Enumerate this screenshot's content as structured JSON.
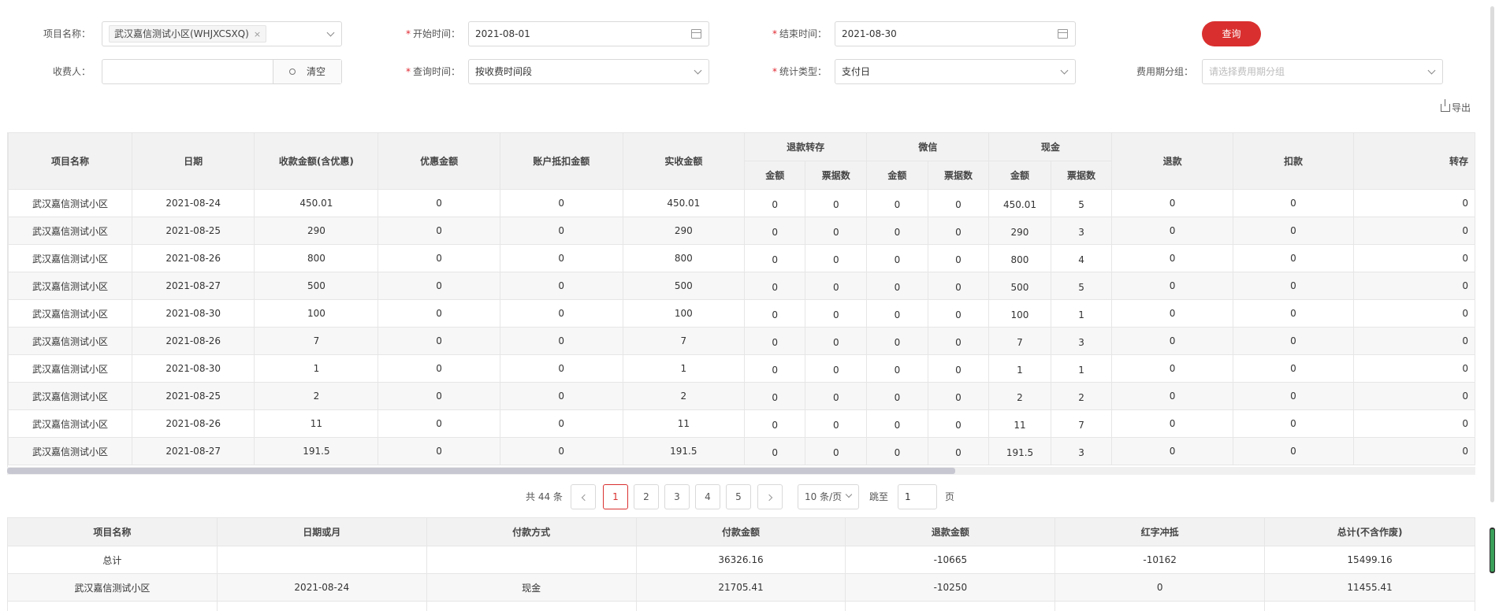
{
  "filters": {
    "project_label": "项目名称：",
    "project_tag": "武汉嘉信测试小区(WHJXCSXQ)",
    "project_tag_close": "×",
    "start_label": "开始时间：",
    "start_value": "2021-08-01",
    "end_label": "结束时间：",
    "end_value": "2021-08-30",
    "query_button": "查询",
    "payee_label": "收费人：",
    "payee_value": "",
    "clear_button": "清空",
    "query_time_label": "查询时间：",
    "query_time_value": "按收费时间段",
    "stat_type_label": "统计类型：",
    "stat_type_value": "支付日",
    "fee_group_label": "费用期分组：",
    "fee_group_placeholder": "请选择费用期分组",
    "export_label": "导出"
  },
  "main_table": {
    "headers": {
      "project": "项目名称",
      "date": "日期",
      "receivable": "收款金额(含优惠)",
      "discount": "优惠金额",
      "account_offset": "账户抵扣金额",
      "actual": "实收金额",
      "refund_transfer": "退款转存",
      "wechat": "微信",
      "cash": "现金",
      "refund": "退款",
      "deduction": "扣款",
      "transfer": "转存",
      "amount": "金额",
      "ticket_count": "票据数"
    },
    "rows": [
      [
        "武汉嘉信测试小区",
        "2021-08-24",
        "450.01",
        "0",
        "0",
        "450.01",
        "0",
        "0",
        "0",
        "0",
        "450.01",
        "5",
        "0",
        "0",
        "0"
      ],
      [
        "武汉嘉信测试小区",
        "2021-08-25",
        "290",
        "0",
        "0",
        "290",
        "0",
        "0",
        "0",
        "0",
        "290",
        "3",
        "0",
        "0",
        "0"
      ],
      [
        "武汉嘉信测试小区",
        "2021-08-26",
        "800",
        "0",
        "0",
        "800",
        "0",
        "0",
        "0",
        "0",
        "800",
        "4",
        "0",
        "0",
        "0"
      ],
      [
        "武汉嘉信测试小区",
        "2021-08-27",
        "500",
        "0",
        "0",
        "500",
        "0",
        "0",
        "0",
        "0",
        "500",
        "5",
        "0",
        "0",
        "0"
      ],
      [
        "武汉嘉信测试小区",
        "2021-08-30",
        "100",
        "0",
        "0",
        "100",
        "0",
        "0",
        "0",
        "0",
        "100",
        "1",
        "0",
        "0",
        "0"
      ],
      [
        "武汉嘉信测试小区",
        "2021-08-26",
        "7",
        "0",
        "0",
        "7",
        "0",
        "0",
        "0",
        "0",
        "7",
        "3",
        "0",
        "0",
        "0"
      ],
      [
        "武汉嘉信测试小区",
        "2021-08-30",
        "1",
        "0",
        "0",
        "1",
        "0",
        "0",
        "0",
        "0",
        "1",
        "1",
        "0",
        "0",
        "0"
      ],
      [
        "武汉嘉信测试小区",
        "2021-08-25",
        "2",
        "0",
        "0",
        "2",
        "0",
        "0",
        "0",
        "0",
        "2",
        "2",
        "0",
        "0",
        "0"
      ],
      [
        "武汉嘉信测试小区",
        "2021-08-26",
        "11",
        "0",
        "0",
        "11",
        "0",
        "0",
        "0",
        "0",
        "11",
        "7",
        "0",
        "0",
        "0"
      ],
      [
        "武汉嘉信测试小区",
        "2021-08-27",
        "191.5",
        "0",
        "0",
        "191.5",
        "0",
        "0",
        "0",
        "0",
        "191.5",
        "3",
        "0",
        "0",
        "0"
      ]
    ]
  },
  "pagination": {
    "total": "共 44 条",
    "pages": [
      "1",
      "2",
      "3",
      "4",
      "5"
    ],
    "current_page": "1",
    "page_size": "10 条/页",
    "jump_label": "跳至",
    "jump_value": "1",
    "page_unit": "页"
  },
  "summary_table": {
    "headers": [
      "项目名称",
      "日期或月",
      "付款方式",
      "付款金额",
      "退款金额",
      "红字冲抵",
      "总计(不含作废)"
    ],
    "rows": [
      [
        "总计",
        "",
        "",
        "36326.16",
        "-10665",
        "-10162",
        "15499.16"
      ],
      [
        "武汉嘉信测试小区",
        "2021-08-24",
        "现金",
        "21705.41",
        "-10250",
        "0",
        "11455.41"
      ],
      [
        "",
        "",
        "",
        "",
        "",
        "",
        ""
      ]
    ]
  },
  "colors": {
    "accent": "#d9302f",
    "required": "#e0262f",
    "header_bg": "#f2f2f2",
    "border": "#e6e6e6"
  },
  "icons": {
    "project_dropdown": "chevron-down-icon",
    "date_picker": "calendar-icon",
    "payee_search": "search-icon",
    "export": "download-icon",
    "prev_page": "chevron-left-icon",
    "next_page": "chevron-right-icon"
  }
}
